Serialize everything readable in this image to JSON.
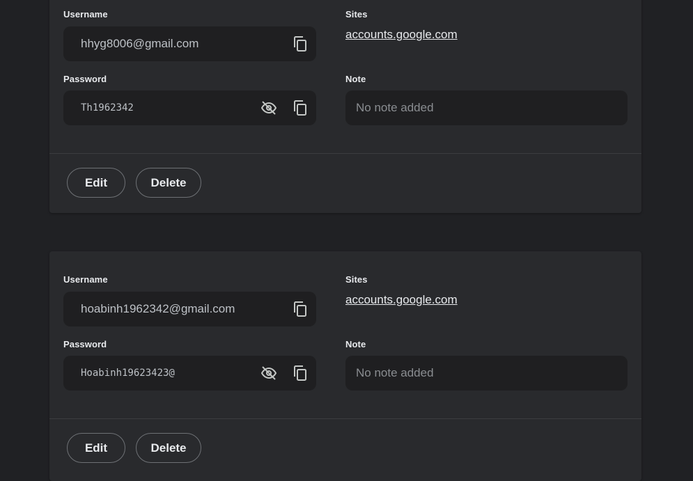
{
  "entries": [
    {
      "username_label": "Username",
      "username": "hhyg8006@gmail.com",
      "sites_label": "Sites",
      "site": "accounts.google.com",
      "password_label": "Password",
      "password": "Th1962342",
      "note_label": "Note",
      "note": "No note added",
      "edit_label": "Edit",
      "delete_label": "Delete"
    },
    {
      "username_label": "Username",
      "username": "hoabinh1962342@gmail.com",
      "sites_label": "Sites",
      "site": "accounts.google.com",
      "password_label": "Password",
      "password": "Hoabinh19623423@",
      "note_label": "Note",
      "note": "No note added",
      "edit_label": "Edit",
      "delete_label": "Delete"
    }
  ],
  "icons": {
    "copy": "copy-icon",
    "visibility_off": "eye-off-icon"
  }
}
